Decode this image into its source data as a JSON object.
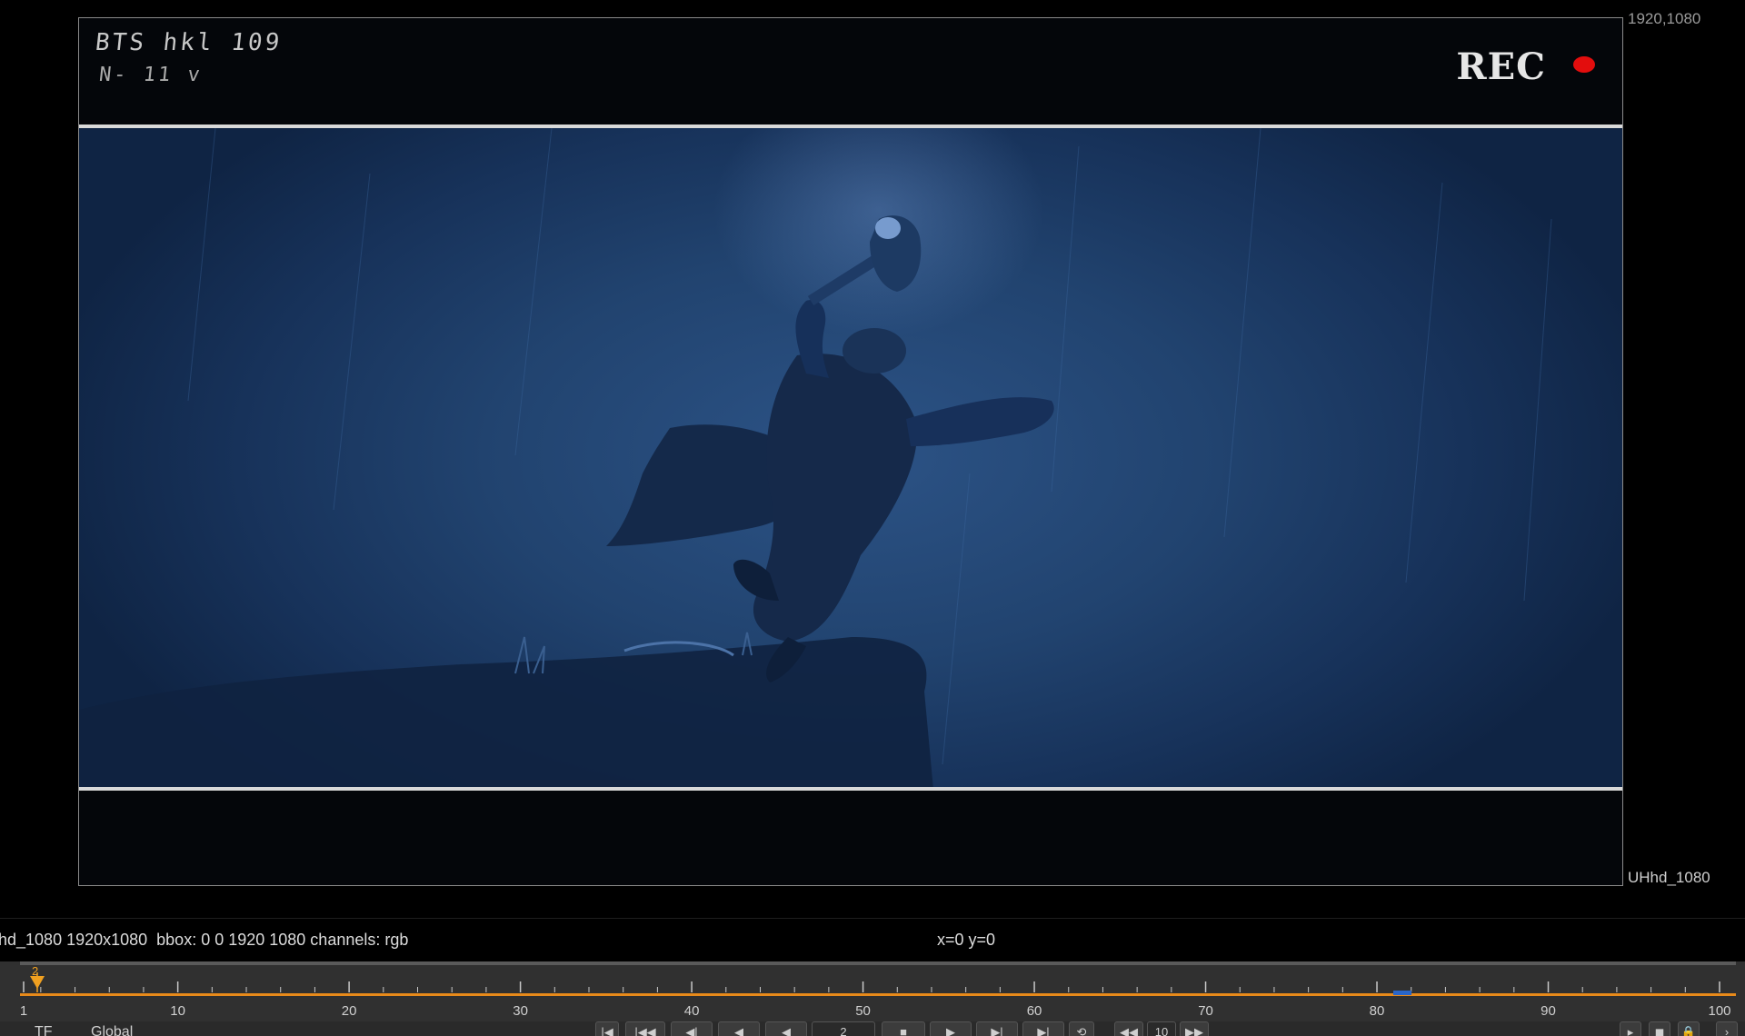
{
  "viewer": {
    "format_size_label": "1920,1080",
    "format_name_label": "UHhd_1080",
    "storyboard": {
      "handwritten_line1": "BTS hkl 109",
      "handwritten_line2": "N- 11 v",
      "rec_label": "REC",
      "rec_color": "#e30d0d"
    }
  },
  "info_bar": {
    "format_info": "hd_1080 1920x1080  bbox: 0 0 1920 1080 channels: rgb",
    "cursor_coords": "x=0 y=0"
  },
  "timeline": {
    "tick_labels": [
      "1",
      "10",
      "20",
      "30",
      "40",
      "50",
      "60",
      "70",
      "80",
      "90",
      "100"
    ],
    "current_frame": "2",
    "accent_color": "#e88a1a",
    "inout_marker_color": "#2a66c8"
  },
  "transport": {
    "fps_value": "TF",
    "scope_value": "Global",
    "frame_field": "2",
    "increment_value": "10",
    "icons": [
      "skip-start-icon",
      "prev-keyframe-icon",
      "step-back-icon",
      "play-backward-icon",
      "stop-icon",
      "play-forward-icon",
      "next-keyframe-icon",
      "skip-end-icon",
      "loop-icon",
      "rewind-icon",
      "fast-forward-icon"
    ]
  }
}
